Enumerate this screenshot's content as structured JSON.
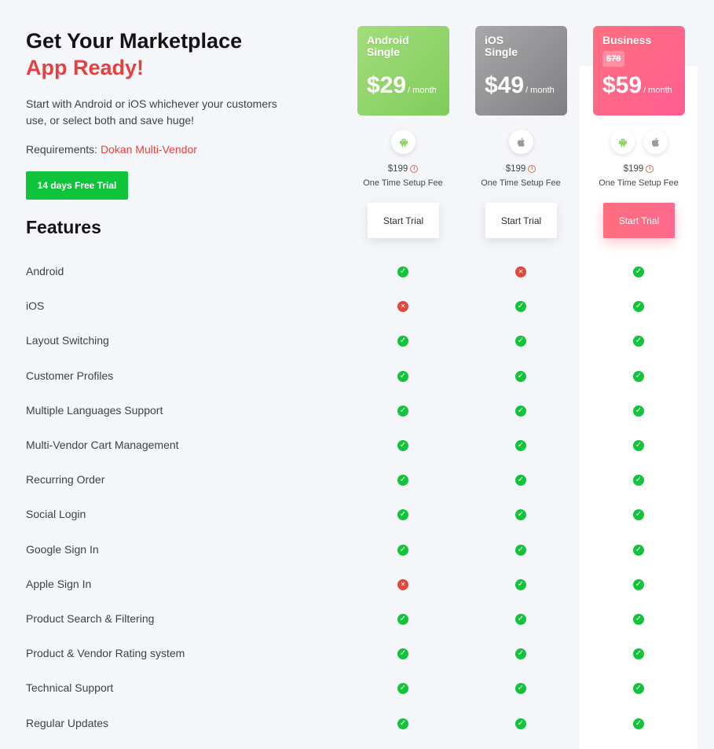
{
  "header": {
    "title_line1": "Get Your Marketplace",
    "title_line2": "App Ready!",
    "intro": "Start with Android or iOS whichever your customers use, or select both and save huge!",
    "requirements_label": "Requirements:",
    "requirements_link": "Dokan Multi-Vendor",
    "trial_button": "14 days Free Trial",
    "features_title": "Features"
  },
  "plans": [
    {
      "name": "Android\nSingle",
      "old_price": "",
      "price": "$29",
      "per": "/ month",
      "setup_fee": "$199",
      "setup_label": "One Time Setup Fee",
      "button": "Start Trial",
      "icons": [
        "android-icon"
      ]
    },
    {
      "name": "iOS\nSingle",
      "old_price": "",
      "price": "$49",
      "per": "/ month",
      "setup_fee": "$199",
      "setup_label": "One Time Setup Fee",
      "button": "Start Trial",
      "icons": [
        "apple-icon"
      ]
    },
    {
      "name": "Business",
      "old_price": "$78",
      "price": "$59",
      "per": "/ month",
      "setup_fee": "$199",
      "setup_label": "One Time Setup Fee",
      "button": "Start Trial",
      "icons": [
        "android-icon",
        "apple-icon"
      ]
    }
  ],
  "features": [
    {
      "label": "Android",
      "support": [
        true,
        false,
        true
      ]
    },
    {
      "label": "iOS",
      "support": [
        false,
        true,
        true
      ]
    },
    {
      "label": "Layout Switching",
      "support": [
        true,
        true,
        true
      ]
    },
    {
      "label": "Customer Profiles",
      "support": [
        true,
        true,
        true
      ]
    },
    {
      "label": "Multiple Languages Support",
      "support": [
        true,
        true,
        true
      ]
    },
    {
      "label": "Multi-Vendor Cart Management",
      "support": [
        true,
        true,
        true
      ]
    },
    {
      "label": "Recurring Order",
      "support": [
        true,
        true,
        true
      ]
    },
    {
      "label": "Social Login",
      "support": [
        true,
        true,
        true
      ]
    },
    {
      "label": "Google Sign In",
      "support": [
        true,
        true,
        true
      ]
    },
    {
      "label": "Apple Sign In",
      "support": [
        false,
        true,
        true
      ]
    },
    {
      "label": "Product Search & Filtering",
      "support": [
        true,
        true,
        true
      ]
    },
    {
      "label": "Product & Vendor Rating system",
      "support": [
        true,
        true,
        true
      ]
    },
    {
      "label": "Technical Support",
      "support": [
        true,
        true,
        true
      ]
    },
    {
      "label": "Regular Updates",
      "support": [
        true,
        true,
        true
      ]
    }
  ],
  "colors": {
    "accent_red": "#e4413f",
    "green": "#12c43a",
    "android_card": "#8fd46a",
    "ios_card": "#949496",
    "business_card": "#ff6788"
  }
}
